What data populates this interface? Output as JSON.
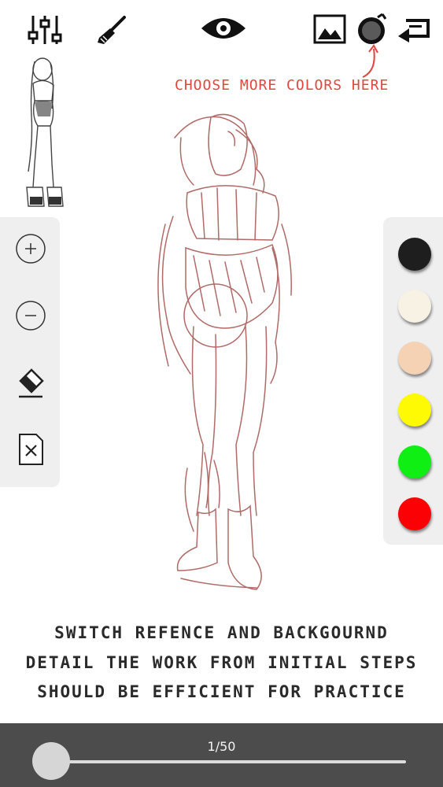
{
  "toolbar": {
    "icons": [
      "sliders-icon",
      "brush-icon",
      "eye-icon",
      "image-icon",
      "color-picker-icon",
      "switch-icon"
    ]
  },
  "hint": {
    "text": "CHOOSE MORE COLORS HERE",
    "color": "#e2463f"
  },
  "left_tools": [
    "zoom-in-icon",
    "zoom-out-icon",
    "eraser-icon",
    "clear-canvas-icon"
  ],
  "palette": {
    "colors": [
      "#1e1e1e",
      "#f7f2e4",
      "#f5d2b3",
      "#fdfa03",
      "#10ef14",
      "#fb0005"
    ]
  },
  "caption": {
    "line1": "SWITCH REFENCE AND BACKGOURND",
    "line2": "DETAIL THE WORK FROM INITIAL STEPS",
    "line3": "SHOULD BE EFFICIENT FOR PRACTICE"
  },
  "progress": {
    "label": "1/50",
    "fraction": 0.02
  },
  "theme": {
    "bar_color": "#4c4c4c",
    "sketch_color": "#b06a67"
  }
}
